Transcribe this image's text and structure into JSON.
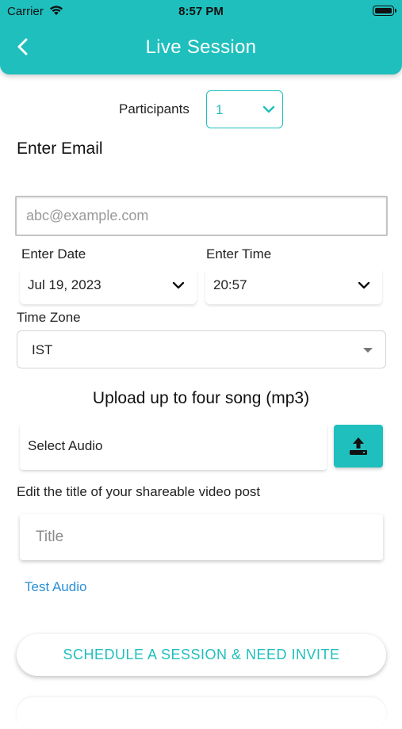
{
  "status_bar": {
    "carrier": "Carrier",
    "time": "8:57 PM"
  },
  "header": {
    "title": "Live Session",
    "back_icon": "chevron-left-icon",
    "color": "#1fbfbd"
  },
  "participants": {
    "label": "Participants",
    "value": "1"
  },
  "email": {
    "heading": "Enter Email",
    "placeholder": "abc@example.com",
    "value": ""
  },
  "date": {
    "label": "Enter Date",
    "value": "Jul 19, 2023"
  },
  "time": {
    "label": "Enter Time",
    "value": "20:57"
  },
  "timezone": {
    "label": "Time Zone",
    "value": "IST"
  },
  "upload": {
    "heading": "Upload up to four song (mp3)",
    "select_label": "Select Audio",
    "button_icon": "upload-icon"
  },
  "video_title": {
    "label": "Edit the title of your shareable video post",
    "placeholder": "Title",
    "value": ""
  },
  "test_audio": {
    "label": "Test Audio",
    "color": "#2b8fd6"
  },
  "schedule_button": {
    "label": "SCHEDULE A SESSION & NEED INVITE"
  }
}
